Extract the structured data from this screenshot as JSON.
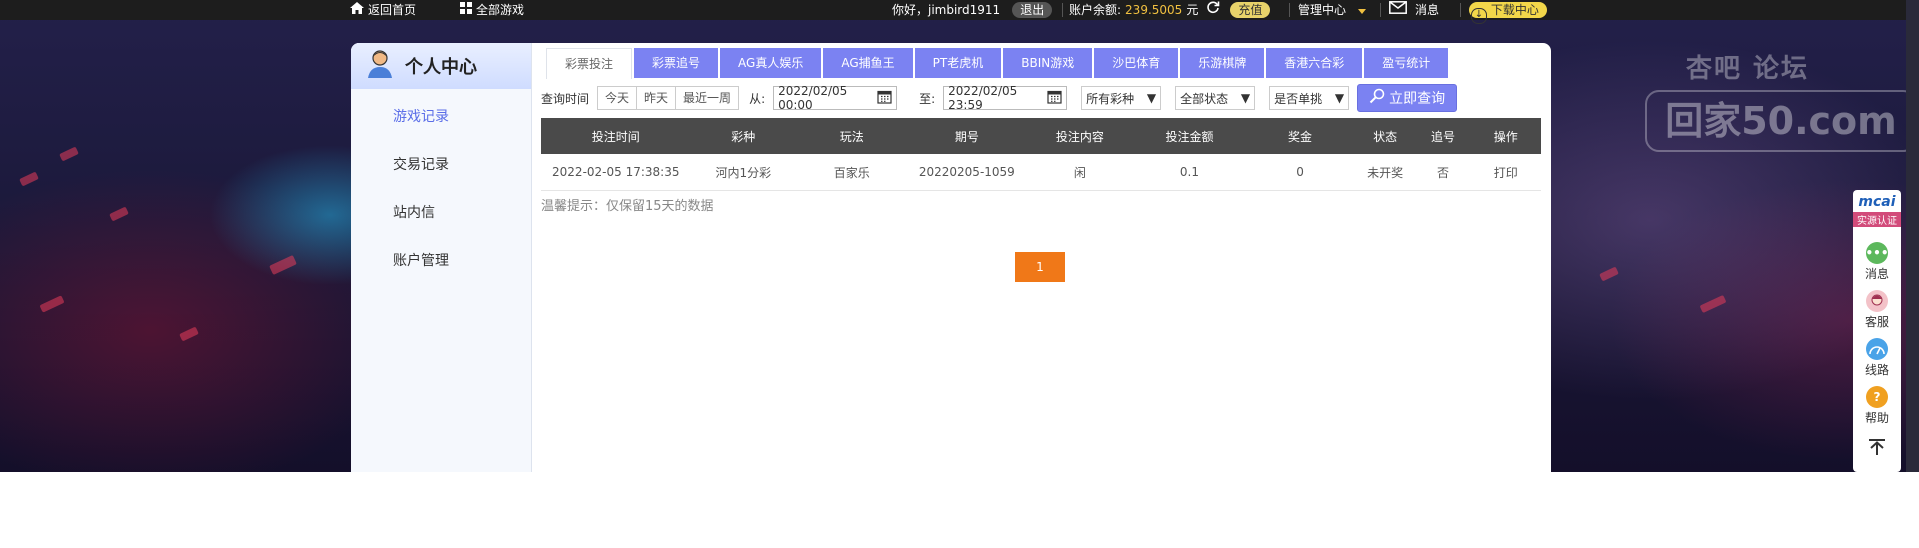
{
  "topbar": {
    "home_label": "返回首页",
    "all_games_label": "全部游戏",
    "greeting": "你好，jimbird1911",
    "logout_label": "退出",
    "balance_label": "账户余额:",
    "balance_value": "239.5005",
    "currency": "元",
    "recharge_label": "充值",
    "admin_label": "管理中心",
    "messages_label": "消息",
    "download_label": "下载中心"
  },
  "watermark": {
    "line1": "杏吧    论坛",
    "line2": "回家50.com"
  },
  "sidebar": {
    "title": "个人中心",
    "items": [
      {
        "label": "游戏记录"
      },
      {
        "label": "交易记录"
      },
      {
        "label": "站内信"
      },
      {
        "label": "账户管理"
      }
    ]
  },
  "tabs": [
    {
      "label": "彩票投注"
    },
    {
      "label": "彩票追号"
    },
    {
      "label": "AG真人娱乐"
    },
    {
      "label": "AG捕鱼王"
    },
    {
      "label": "PT老虎机"
    },
    {
      "label": "BBIN游戏"
    },
    {
      "label": "沙巴体育"
    },
    {
      "label": "乐游棋牌"
    },
    {
      "label": "香港六合彩"
    },
    {
      "label": "盈亏统计"
    }
  ],
  "filters": {
    "query_time_label": "查询时间",
    "today": "今天",
    "yesterday": "昨天",
    "last_week": "最近一周",
    "from_label": "从:",
    "from_value": "2022/02/05 00:00",
    "to_label": "至:",
    "to_value": "2022/02/05 23:59",
    "lottery_select": "所有彩种",
    "status_select": "全部状态",
    "single_select": "是否单挑",
    "query_button": "立即查询"
  },
  "table": {
    "headers": [
      "投注时间",
      "彩种",
      "玩法",
      "期号",
      "投注内容",
      "投注金额",
      "奖金",
      "状态",
      "追号",
      "操作"
    ],
    "rows": [
      [
        "2022-02-05 17:38:35",
        "河内1分彩",
        "百家乐",
        "20220205-1059",
        "闲",
        "0.1",
        "0",
        "未开奖",
        "否",
        "打印"
      ]
    ]
  },
  "tip": "温馨提示：仅保留15天的数据",
  "pagination": {
    "current": "1"
  },
  "floatbar": {
    "brand": "mcai",
    "badge": "实源认证",
    "items": [
      {
        "label": "消息"
      },
      {
        "label": "客服"
      },
      {
        "label": "线路"
      },
      {
        "label": "帮助"
      }
    ]
  }
}
